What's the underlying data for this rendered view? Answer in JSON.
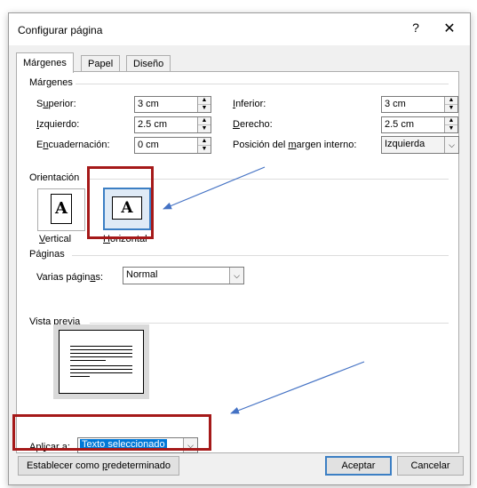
{
  "window": {
    "title": "Configurar página",
    "help": "?",
    "close": "✕"
  },
  "tabs": [
    {
      "label": "Márgenes",
      "active": true
    },
    {
      "label": "Papel"
    },
    {
      "label": "Diseño"
    }
  ],
  "margins": {
    "section": "Márgenes",
    "top_label_pre": "S",
    "top_label_u": "u",
    "top_label_post": "perior:",
    "top_value": "3 cm",
    "left_label_u": "I",
    "left_label_post": "zquierdo:",
    "left_value": "2.5 cm",
    "gutter_label_pre": "E",
    "gutter_label_u": "n",
    "gutter_label_post": "cuadernación:",
    "gutter_value": "0 cm",
    "bottom_label_u": "I",
    "bottom_label_post": "nferior:",
    "bottom_value": "3 cm",
    "right_label_u": "D",
    "right_label_post": "erecho:",
    "right_value": "2.5 cm",
    "gutter_pos_label_pre": "Posición del ",
    "gutter_pos_label_u": "m",
    "gutter_pos_label_post": "argen interno:",
    "gutter_pos_value": "Izquierda"
  },
  "orientation": {
    "section": "Orientación",
    "glyph": "A",
    "portrait_u": "V",
    "portrait_post": "ertical",
    "landscape_u": "H",
    "landscape_post": "orizontal",
    "selected": "Horizontal"
  },
  "pages": {
    "section": "Páginas",
    "multiple_pre": "Varias págin",
    "multiple_u": "a",
    "multiple_post": "s:",
    "multiple_value": "Normal"
  },
  "preview": {
    "section": "Vista previa"
  },
  "apply": {
    "label_pre": "Apl",
    "label_u": "i",
    "label_post": "car a:",
    "value": "Texto seleccionado"
  },
  "buttons": {
    "default_pre": "Establecer como ",
    "default_u": "p",
    "default_post": "redeterminado",
    "ok": "Aceptar",
    "cancel": "Cancelar"
  },
  "colors": {
    "highlight_border": "#a51919",
    "arrow": "#4472c4",
    "selection": "#0078d7"
  }
}
